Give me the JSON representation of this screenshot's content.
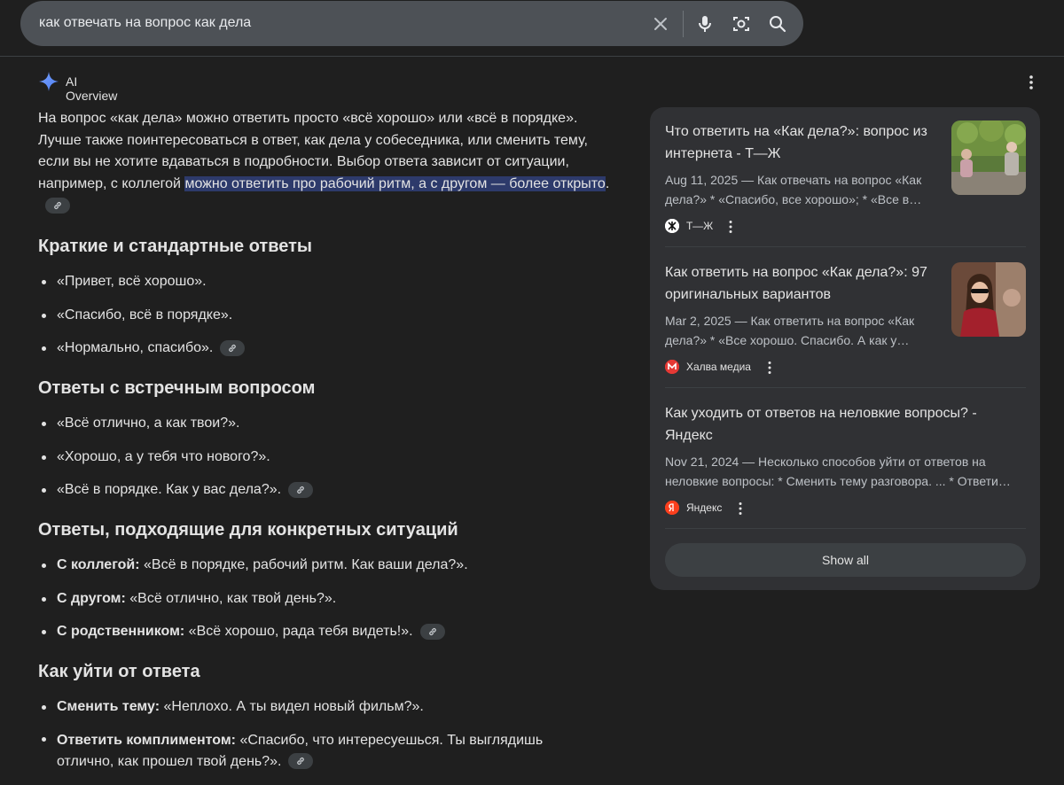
{
  "search": {
    "query": "как отвечать на вопрос как дела",
    "icons": [
      "close-icon",
      "mic-icon",
      "camera-lens-icon",
      "search-icon"
    ]
  },
  "ai_overview": {
    "label": "AI Overview",
    "intro": {
      "text1": "На вопрос «как дела» можно ответить просто «всё хорошо» или «всё в порядке». Лучше также поинтересоваться в ответ, как дела у собеседника, или сменить тему, если вы не хотите вдаваться в подробности. Выбор ответа зависит от ситуации, например, с коллегой ",
      "highlight": "можно ответить про рабочий ритм, а с другом — более открыто",
      "end": "."
    },
    "sections": [
      {
        "heading": "Краткие и стандартные ответы",
        "items": [
          {
            "bold": "",
            "text": "«Привет, всё хорошо»."
          },
          {
            "bold": "",
            "text": "«Спасибо, всё в порядке»."
          },
          {
            "bold": "",
            "text": "«Нормально, спасибо»."
          }
        ]
      },
      {
        "heading": "Ответы с встречным вопросом",
        "items": [
          {
            "bold": "",
            "text": "«Всё отлично, а как твои?»."
          },
          {
            "bold": "",
            "text": "«Хорошо, а у тебя что нового?»."
          },
          {
            "bold": "",
            "text": "«Всё в порядке. Как у вас дела?»."
          }
        ]
      },
      {
        "heading": "Ответы, подходящие для конкретных ситуаций",
        "items": [
          {
            "bold": "С коллегой:",
            "text": " «Всё в порядке, рабочий ритм. Как ваши дела?»."
          },
          {
            "bold": "С другом:",
            "text": " «Всё отлично, как твой день?»."
          },
          {
            "bold": "С родственником:",
            "text": " «Всё хорошо, рада тебя видеть!»."
          }
        ]
      },
      {
        "heading": "Как уйти от ответа",
        "items": [
          {
            "bold": "Сменить тему:",
            "text": " «Неплохо. А ты видел новый фильм?»."
          },
          {
            "bold": "Ответить комплиментом:",
            "text": " «Спасибо, что интересуешься. Ты выглядишь отлично, как прошел твой день?»."
          }
        ]
      }
    ]
  },
  "sources": {
    "items": [
      {
        "title": "Что ответить на «Как дела?»: вопрос из интернета - Т—Ж",
        "snippet": "Aug 11, 2025 — Как отвечать на вопрос «Как дела?» * «Спасибо, все хорошо»; * «Все в…",
        "site": "Т—Ж",
        "favicon_color": "#ffffff"
      },
      {
        "title": "Как ответить на вопрос «Как дела?»: 97 оригинальных вариантов",
        "snippet": "Mar 2, 2025 — Как ответить на вопрос «Как дела?» * «Все хорошо. Спасибо. А как у…",
        "site": "Халва медиа",
        "favicon_color": "#e53935"
      },
      {
        "title": "Как уходить от ответов на неловкие вопросы? - Яндекс",
        "snippet": "Nov 21, 2024 — Несколько способов уйти от ответов на неловкие вопросы: * Сменить тему разговора. ... * Ответи…",
        "site": "Яндекс",
        "favicon_color": "#fc3f1d"
      }
    ],
    "show_all": "Show all"
  }
}
